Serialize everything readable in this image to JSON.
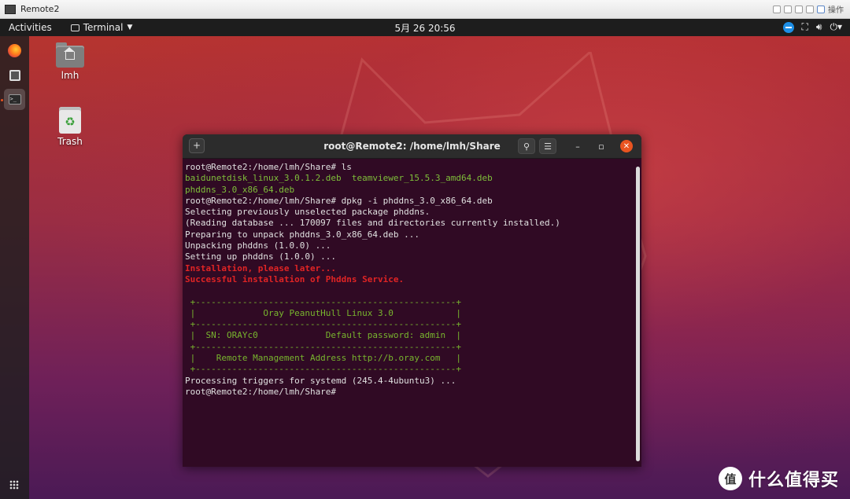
{
  "outer_window": {
    "title": "Remote2",
    "controls_label": "操作"
  },
  "topbar": {
    "activities": "Activities",
    "app_menu": "Terminal",
    "clock": "5月 26  20:56"
  },
  "desktop": {
    "icons": [
      {
        "label": "lmh"
      },
      {
        "label": "Trash"
      }
    ]
  },
  "terminal": {
    "title": "root@Remote2: /home/lmh/Share",
    "lines": [
      {
        "text": "root@Remote2:/home/lmh/Share# ls",
        "style": "normal"
      },
      {
        "text": "baidunetdisk_linux_3.0.1.2.deb  teamviewer_15.5.3_amd64.deb",
        "style": "green"
      },
      {
        "text": "phddns_3.0_x86_64.deb",
        "style": "green"
      },
      {
        "text": "root@Remote2:/home/lmh/Share# dpkg -i phddns_3.0_x86_64.deb",
        "style": "normal"
      },
      {
        "text": "Selecting previously unselected package phddns.",
        "style": "normal"
      },
      {
        "text": "(Reading database ... 170097 files and directories currently installed.)",
        "style": "normal"
      },
      {
        "text": "Preparing to unpack phddns_3.0_x86_64.deb ...",
        "style": "normal"
      },
      {
        "text": "Unpacking phddns (1.0.0) ...",
        "style": "normal"
      },
      {
        "text": "Setting up phddns (1.0.0) ...",
        "style": "normal"
      },
      {
        "text": "Installation, please later...",
        "style": "red"
      },
      {
        "text": "Successful installation of Phddns Service.",
        "style": "red"
      },
      {
        "text": "",
        "style": "normal"
      },
      {
        "text": " +--------------------------------------------------+",
        "style": "lime"
      },
      {
        "text": " |             Oray PeanutHull Linux 3.0            |",
        "style": "lime"
      },
      {
        "text": " +--------------------------------------------------+",
        "style": "lime"
      },
      {
        "text": " |  SN: ORAYc0             Default password: admin  |",
        "style": "lime"
      },
      {
        "text": " +--------------------------------------------------+",
        "style": "lime"
      },
      {
        "text": " |    Remote Management Address http://b.oray.com   |",
        "style": "lime"
      },
      {
        "text": " +--------------------------------------------------+",
        "style": "lime"
      },
      {
        "text": "Processing triggers for systemd (245.4-4ubuntu3) ...",
        "style": "normal"
      },
      {
        "text": "root@Remote2:/home/lmh/Share# ",
        "style": "normal"
      }
    ]
  },
  "watermark": {
    "logo_char": "值",
    "text": "什么值得买"
  }
}
